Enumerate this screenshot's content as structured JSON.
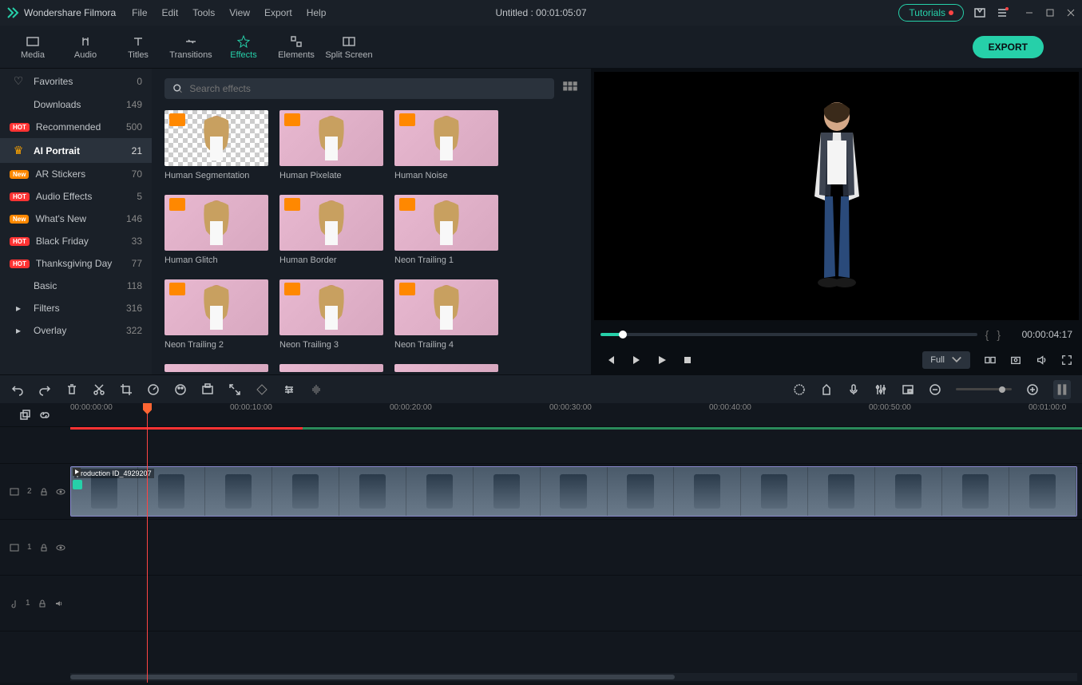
{
  "titlebar": {
    "app_name": "Wondershare Filmora",
    "menus": [
      "File",
      "Edit",
      "Tools",
      "View",
      "Export",
      "Help"
    ],
    "project_title": "Untitled : 00:01:05:07",
    "tutorials_label": "Tutorials"
  },
  "toptabs": {
    "items": [
      {
        "label": "Media"
      },
      {
        "label": "Audio"
      },
      {
        "label": "Titles"
      },
      {
        "label": "Transitions"
      },
      {
        "label": "Effects"
      },
      {
        "label": "Elements"
      },
      {
        "label": "Split Screen"
      }
    ],
    "active": 4,
    "export_label": "EXPORT"
  },
  "sidebar": {
    "items": [
      {
        "badge": "heart",
        "label": "Favorites",
        "count": "0"
      },
      {
        "badge": "",
        "label": "Downloads",
        "count": "149"
      },
      {
        "badge": "hot",
        "label": "Recommended",
        "count": "500"
      },
      {
        "badge": "crown",
        "label": "AI Portrait",
        "count": "21",
        "active": true
      },
      {
        "badge": "new",
        "label": "AR Stickers",
        "count": "70"
      },
      {
        "badge": "hot",
        "label": "Audio Effects",
        "count": "5"
      },
      {
        "badge": "new",
        "label": "What's New",
        "count": "146"
      },
      {
        "badge": "hot",
        "label": "Black Friday",
        "count": "33"
      },
      {
        "badge": "hot",
        "label": "Thanksgiving Day",
        "count": "77"
      },
      {
        "badge": "",
        "label": "Basic",
        "count": "118"
      },
      {
        "badge": "caret",
        "label": "Filters",
        "count": "316"
      },
      {
        "badge": "caret",
        "label": "Overlay",
        "count": "322"
      }
    ]
  },
  "search": {
    "placeholder": "Search effects"
  },
  "effects": [
    {
      "label": "Human Segmentation",
      "checker": true
    },
    {
      "label": "Human Pixelate"
    },
    {
      "label": "Human Noise"
    },
    {
      "label": "Human Glitch"
    },
    {
      "label": "Human Border"
    },
    {
      "label": "Neon Trailing 1"
    },
    {
      "label": "Neon Trailing 2"
    },
    {
      "label": "Neon Trailing 3"
    },
    {
      "label": "Neon Trailing 4"
    }
  ],
  "preview": {
    "timecode": "00:00:04:17",
    "quality_label": "Full"
  },
  "timeline": {
    "ruler": [
      "00:00:00:00",
      "00:00:10:00",
      "00:00:20:00",
      "00:00:30:00",
      "00:00:40:00",
      "00:00:50:00",
      "00:01:00:0"
    ],
    "tracks": [
      {
        "name": "",
        "type": "spacer"
      },
      {
        "name": "2",
        "type": "video",
        "icons": [
          "film",
          "lock",
          "eye"
        ]
      },
      {
        "name": "1",
        "type": "video",
        "icons": [
          "film",
          "lock",
          "eye"
        ]
      },
      {
        "name": "1",
        "type": "audio",
        "icons": [
          "music",
          "lock",
          "speaker"
        ]
      }
    ],
    "clip_label": "production ID_4929207"
  }
}
